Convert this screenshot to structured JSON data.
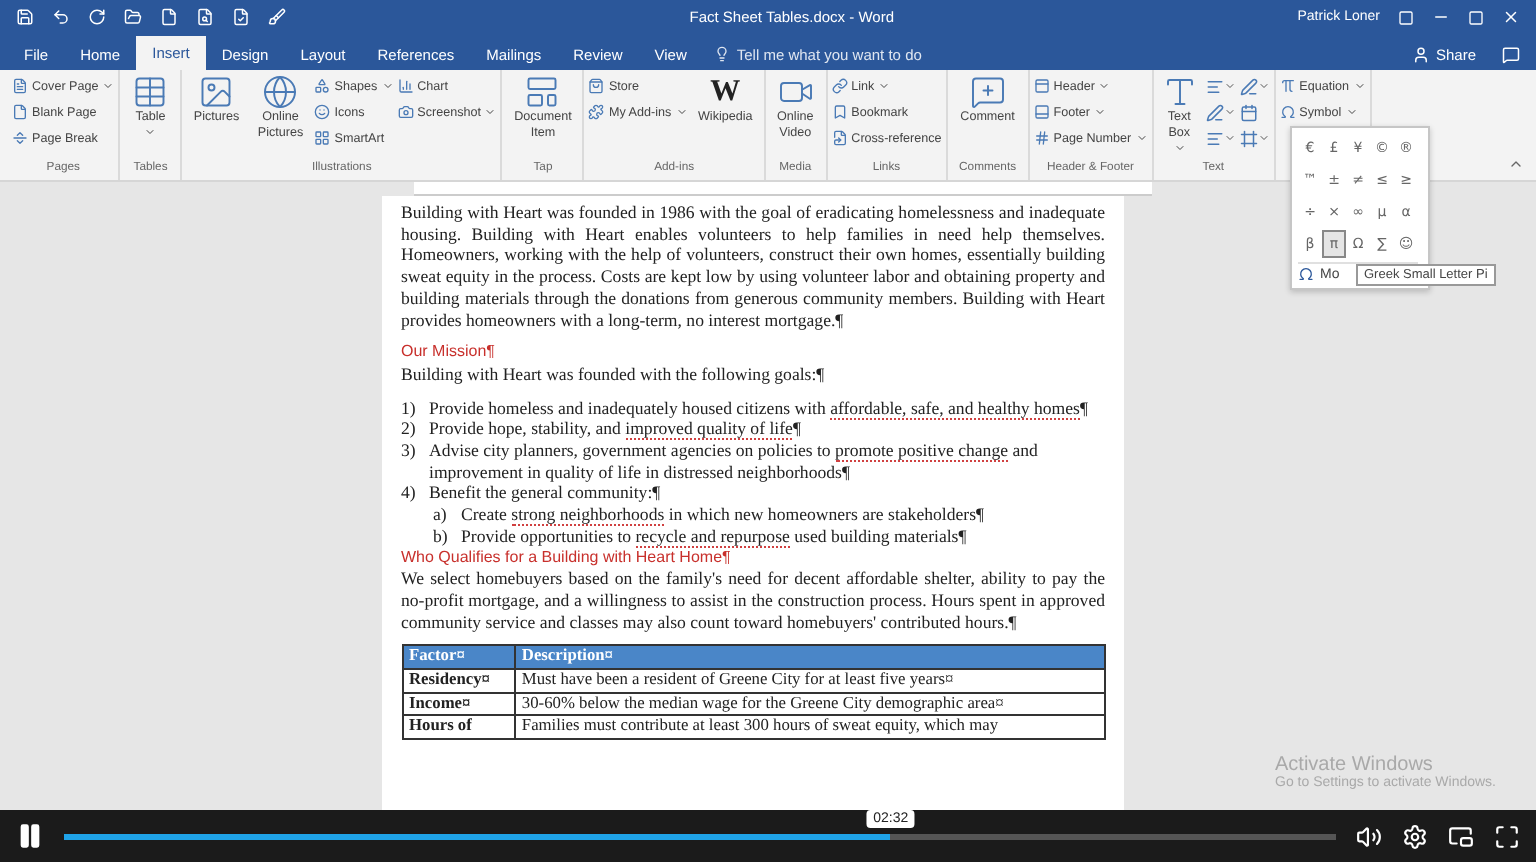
{
  "title_bar": {
    "title": "Fact Sheet Tables.docx - Word",
    "user": "Patrick Loner"
  },
  "tabs": [
    {
      "label": "File",
      "selected": false
    },
    {
      "label": "Home",
      "selected": false
    },
    {
      "label": "Insert",
      "selected": true
    },
    {
      "label": "Design",
      "selected": false
    },
    {
      "label": "Layout",
      "selected": false
    },
    {
      "label": "References",
      "selected": false
    },
    {
      "label": "Mailings",
      "selected": false
    },
    {
      "label": "Review",
      "selected": false
    },
    {
      "label": "View",
      "selected": false
    }
  ],
  "tell_me": {
    "placeholder": "Tell me what you want to do"
  },
  "share": "Share",
  "ribbon": [
    {
      "label": "Pages",
      "columns": [
        [
          {
            "label": "Cover Page",
            "kind": "small",
            "dropdown": true
          },
          {
            "label": "Blank Page",
            "kind": "small",
            "dropdown": false
          },
          {
            "label": "Page Break",
            "kind": "small",
            "dropdown": false
          }
        ]
      ]
    },
    {
      "label": "Tables",
      "columns": [
        [
          {
            "label": "Table",
            "kind": "large",
            "dropdown": true
          }
        ]
      ]
    },
    {
      "label": "Illustrations",
      "columns": [
        [
          {
            "label": "Pictures",
            "kind": "large",
            "dropdown": false
          }
        ],
        [
          {
            "label": "Online Pictures",
            "kind": "large",
            "dropdown": false
          }
        ],
        [
          {
            "label": "Shapes",
            "kind": "small",
            "dropdown": true
          },
          {
            "label": "Icons",
            "kind": "small",
            "dropdown": false
          },
          {
            "label": "SmartArt",
            "kind": "small",
            "dropdown": false
          }
        ],
        [
          {
            "label": "Chart",
            "kind": "small",
            "dropdown": false
          },
          {
            "label": "Screenshot",
            "kind": "small",
            "dropdown": true
          }
        ]
      ]
    },
    {
      "label": "Tap",
      "columns": [
        [
          {
            "label": "Document Item",
            "kind": "large",
            "dropdown": false
          }
        ]
      ]
    },
    {
      "label": "Add-ins",
      "columns": [
        [
          {
            "label": "Store",
            "kind": "small",
            "dropdown": false
          },
          {
            "label": "My Add-ins",
            "kind": "small",
            "dropdown": true
          }
        ],
        [
          {
            "label": "Wikipedia",
            "kind": "large",
            "dropdown": false,
            "glyph": "W"
          }
        ]
      ]
    },
    {
      "label": "Media",
      "columns": [
        [
          {
            "label": "Online Video",
            "kind": "large",
            "dropdown": false
          }
        ]
      ]
    },
    {
      "label": "Links",
      "columns": [
        [
          {
            "label": "Link",
            "kind": "small",
            "dropdown": true
          },
          {
            "label": "Bookmark",
            "kind": "small",
            "dropdown": false
          },
          {
            "label": "Cross-reference",
            "kind": "small",
            "dropdown": false
          }
        ]
      ]
    },
    {
      "label": "Comments",
      "columns": [
        [
          {
            "label": "Comment",
            "kind": "large",
            "dropdown": false
          }
        ]
      ]
    },
    {
      "label": "Header & Footer",
      "columns": [
        [
          {
            "label": "Header",
            "kind": "small",
            "dropdown": true
          },
          {
            "label": "Footer",
            "kind": "small",
            "dropdown": true
          },
          {
            "label": "Page Number",
            "kind": "small",
            "dropdown": true
          }
        ]
      ]
    },
    {
      "label": "Text",
      "columns": [
        [
          {
            "label": "Text Box",
            "kind": "large",
            "dropdown": true
          }
        ],
        [
          {
            "kind": "tool",
            "dropdown": true
          },
          {
            "kind": "tool",
            "dropdown": true
          },
          {
            "kind": "tool",
            "dropdown": true
          }
        ],
        [
          {
            "kind": "tool",
            "dropdown": true
          },
          {
            "kind": "tool",
            "dropdown": false
          },
          {
            "kind": "tool",
            "dropdown": true
          }
        ]
      ]
    },
    {
      "columns": [
        [
          {
            "label": "Equation",
            "kind": "small",
            "dropdown": true
          },
          {
            "label": "Symbol",
            "kind": "small",
            "dropdown": true
          }
        ]
      ]
    }
  ],
  "symbol_menu": {
    "symbols": [
      {
        "char": "€",
        "selected": false
      },
      {
        "char": "£",
        "selected": false
      },
      {
        "char": "¥",
        "selected": false
      },
      {
        "char": "©",
        "selected": false
      },
      {
        "char": "®",
        "selected": false
      },
      {
        "char": "™",
        "selected": false
      },
      {
        "char": "±",
        "selected": false
      },
      {
        "char": "≠",
        "selected": false
      },
      {
        "char": "≤",
        "selected": false
      },
      {
        "char": "≥",
        "selected": false
      },
      {
        "char": "÷",
        "selected": false
      },
      {
        "char": "×",
        "selected": false
      },
      {
        "char": "∞",
        "selected": false
      },
      {
        "char": "µ",
        "selected": false
      },
      {
        "char": "α",
        "selected": false
      },
      {
        "char": "β",
        "selected": false
      },
      {
        "char": "π",
        "selected": true
      },
      {
        "char": "Ω",
        "selected": false
      },
      {
        "char": "∑",
        "selected": false
      },
      {
        "char": "☺",
        "selected": false
      }
    ],
    "more": "Mo",
    "tooltip": "Greek Small Letter Pi"
  },
  "document": [
    {
      "kind": "paragraph",
      "text": "Building with Heart was founded in 1986 with the goal of eradicating homelessness and inadequate housing. Building with Heart enables volunteers to help families in need help themselves. Homeowners, working with the help of volunteers, construct their own homes, essentially building sweat equity in the process. Costs are kept low by using volunteer labor and obtaining property and building materials through the donations from generous community members. Building with Heart provides homeowners with a long-term, no interest mortgage.¶"
    },
    {
      "kind": "heading",
      "text": "Our Mission¶"
    },
    {
      "kind": "paragraph",
      "text": "Building with Heart was founded with the following goals:¶"
    },
    {
      "kind": "list",
      "number": "1)",
      "parts": [
        {
          "text": "Provide homeless and inadequately housed citizens with ",
          "underlined": false
        },
        {
          "text": "affordable, safe, and healthy homes",
          "underlined": true
        },
        {
          "text": "¶",
          "underlined": false
        }
      ]
    },
    {
      "kind": "list",
      "number": "2)",
      "parts": [
        {
          "text": "Provide hope, stability, and ",
          "underlined": false
        },
        {
          "text": "improved quality of life",
          "underlined": true
        },
        {
          "text": "¶",
          "underlined": false
        }
      ]
    },
    {
      "kind": "list",
      "number": "3)",
      "parts": [
        {
          "text": "Advise city planners, government agencies on policies to ",
          "underlined": false
        },
        {
          "text": "promote positive change",
          "underlined": true
        },
        {
          "text": " and improvement in quality of life in distressed neighborhoods¶",
          "underlined": false
        }
      ]
    },
    {
      "kind": "list",
      "number": "4)",
      "parts": [
        {
          "text": "Benefit the general community:¶",
          "underlined": false
        }
      ]
    },
    {
      "kind": "sublist",
      "number": "a)",
      "parts": [
        {
          "text": "Create ",
          "underlined": false
        },
        {
          "text": "strong neighborhoods",
          "underlined": true
        },
        {
          "text": " in which new homeowners are stakeholders¶",
          "underlined": false
        }
      ]
    },
    {
      "kind": "sublist",
      "number": "b)",
      "parts": [
        {
          "text": "Provide opportunities to ",
          "underlined": false
        },
        {
          "text": "recycle and repurpose",
          "underlined": true
        },
        {
          "text": " used building materials¶",
          "underlined": false
        }
      ]
    },
    {
      "kind": "heading",
      "text": "Who Qualifies for a Building with Heart Home¶"
    },
    {
      "kind": "paragraph",
      "text": "We select homebuyers based on the family's need for decent affordable shelter, ability to pay the no-profit mortgage, and a willingness to assist in the construction process. Hours spent in approved community service and classes may also count toward homebuyers' contributed hours.¶"
    }
  ],
  "table": {
    "columns": [
      "Factor¤",
      "Description¤"
    ],
    "rows": [
      [
        "Residency¤",
        "Must have been a resident of Greene City for at least five years¤"
      ],
      [
        "Income¤",
        "30-60% below the median wage for the Greene City demographic area¤"
      ],
      [
        "Hours of",
        "Families must contribute at least 300 hours of sweat equity, which may"
      ]
    ]
  },
  "activate_windows": {
    "title": "Activate Windows",
    "subtitle": "Go to Settings to activate Windows."
  },
  "player": {
    "time": "02:32",
    "progress": {
      "level": 0.65
    }
  }
}
